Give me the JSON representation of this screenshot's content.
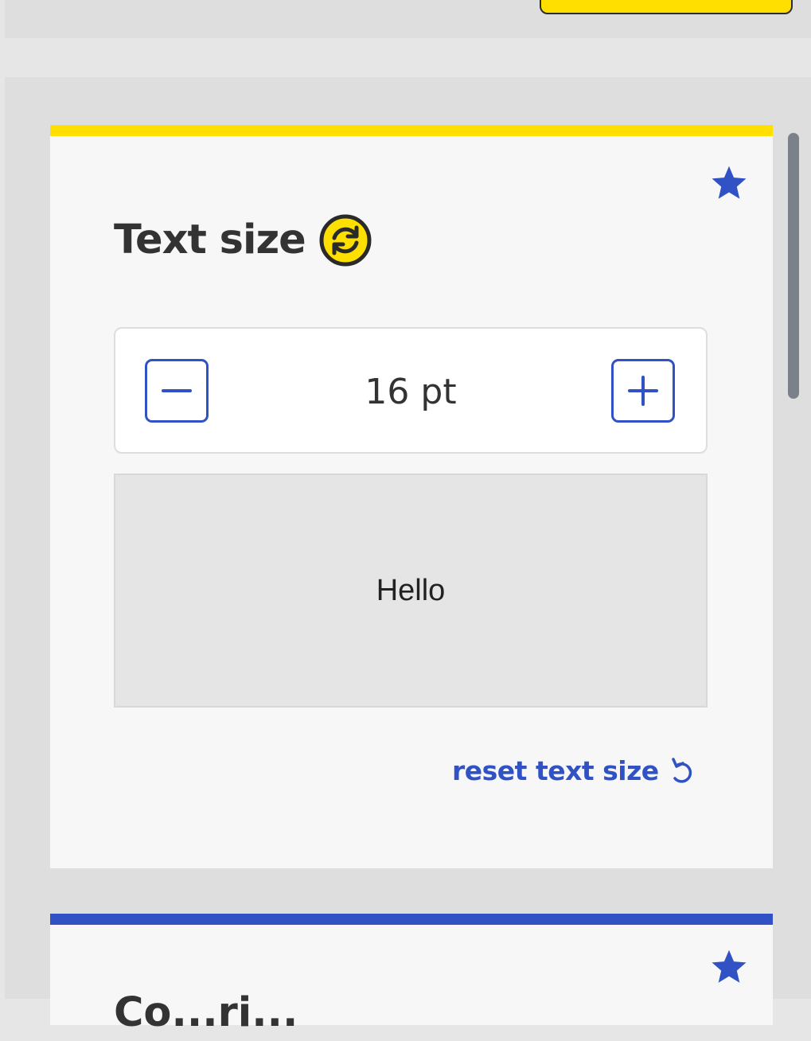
{
  "colors": {
    "accent_yellow": "#ffdf00",
    "accent_blue": "#3052c4",
    "panel_bg": "#dedede",
    "card_bg": "#f7f7f7"
  },
  "text_size_card": {
    "title": "Text size",
    "title_icon": "sync-icon",
    "favorite_icon": "star-icon",
    "stepper": {
      "decrease_icon": "minus-square-icon",
      "value": "16 pt",
      "increase_icon": "plus-square-icon"
    },
    "preview_text": "Hello",
    "reset_label": "reset text size",
    "reset_icon": "undo-icon"
  },
  "next_card": {
    "favorite_icon": "star-icon",
    "title": "Co...ri..."
  }
}
